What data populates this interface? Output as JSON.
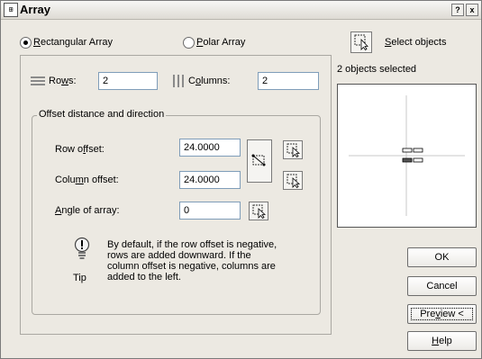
{
  "window": {
    "title": "Array",
    "icon_name": "array-command-icon",
    "help_btn": "?",
    "close_btn": "x"
  },
  "array_type": {
    "rectangular": {
      "pre": "",
      "key": "R",
      "post": "ectangular Array",
      "selected": true
    },
    "polar": {
      "pre": "",
      "key": "P",
      "post": "olar Array",
      "selected": false
    }
  },
  "rows": {
    "label_pre": "Ro",
    "label_key": "w",
    "label_post": "s:",
    "value": "2",
    "icon": "rows-icon"
  },
  "columns": {
    "label_pre": "C",
    "label_key": "o",
    "label_post": "lumns:",
    "value": "2",
    "icon": "columns-icon"
  },
  "offset_group": {
    "legend": "Offset distance and direction",
    "row_offset": {
      "label_pre": "Row o",
      "label_key": "f",
      "label_post": "fset:",
      "value": "24.0000"
    },
    "column_offset": {
      "label_pre": "Colu",
      "label_key": "m",
      "label_post": "n offset:",
      "value": "24.0000"
    },
    "angle": {
      "label_pre": "",
      "label_key": "A",
      "label_post": "ngle of array:",
      "value": "0"
    }
  },
  "tip": {
    "label": "Tip",
    "icon": "lightbulb-icon",
    "text_lines": [
      "By default, if the row offset is negative,",
      "rows are added downward.  If the",
      "column offset is negative, columns are",
      "added to the left."
    ]
  },
  "select": {
    "label_pre": "",
    "label_key": "S",
    "label_post": "elect objects",
    "status": "2 objects selected"
  },
  "buttons": {
    "ok": "OK",
    "cancel": "Cancel",
    "preview": {
      "pre": "Pre",
      "key": "v",
      "post": "iew <"
    },
    "help": {
      "pre": "",
      "key": "H",
      "post": "elp"
    }
  }
}
